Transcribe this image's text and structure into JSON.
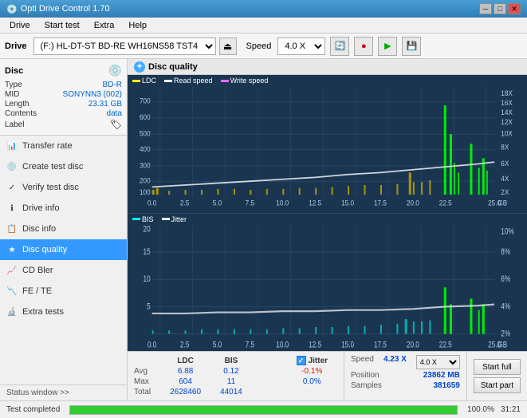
{
  "titlebar": {
    "title": "Opti Drive Control 1.70",
    "icon": "💿",
    "btn_min": "─",
    "btn_max": "□",
    "btn_close": "✕"
  },
  "menubar": {
    "items": [
      "Drive",
      "Start test",
      "Extra",
      "Help"
    ]
  },
  "toolbar": {
    "drive_label": "Drive",
    "drive_value": "(F:)  HL-DT-ST BD-RE  WH16NS58 TST4",
    "eject_icon": "⏏",
    "speed_label": "Speed",
    "speed_value": "4.0 X",
    "icon1": "🔄",
    "icon2": "🔴",
    "icon3": "🟢",
    "icon4": "💾"
  },
  "sidebar": {
    "disc_title": "Disc",
    "disc_icon": "💿",
    "disc_rows": [
      {
        "key": "Type",
        "value": "BD-R"
      },
      {
        "key": "MID",
        "value": "SONYNN3 (002)"
      },
      {
        "key": "Length",
        "value": "23.31 GB"
      },
      {
        "key": "Contents",
        "value": "data"
      },
      {
        "key": "Label",
        "value": ""
      }
    ],
    "nav_items": [
      {
        "id": "transfer-rate",
        "label": "Transfer rate",
        "icon": "📊",
        "active": false
      },
      {
        "id": "create-test-disc",
        "label": "Create test disc",
        "icon": "💿",
        "active": false
      },
      {
        "id": "verify-test-disc",
        "label": "Verify test disc",
        "icon": "✓",
        "active": false
      },
      {
        "id": "drive-info",
        "label": "Drive info",
        "icon": "ℹ",
        "active": false
      },
      {
        "id": "disc-info",
        "label": "Disc info",
        "icon": "📋",
        "active": false
      },
      {
        "id": "disc-quality",
        "label": "Disc quality",
        "icon": "★",
        "active": true
      },
      {
        "id": "cd-bler",
        "label": "CD Bler",
        "icon": "📈",
        "active": false
      },
      {
        "id": "fe-te",
        "label": "FE / TE",
        "icon": "📉",
        "active": false
      },
      {
        "id": "extra-tests",
        "label": "Extra tests",
        "icon": "🔬",
        "active": false
      }
    ],
    "status_window": "Status window >>"
  },
  "panel": {
    "header": "Disc quality",
    "chart1": {
      "legend": [
        {
          "label": "LDC",
          "color": "#ffff00"
        },
        {
          "label": "Read speed",
          "color": "#ffffff"
        },
        {
          "label": "Write speed",
          "color": "#ff66ff"
        }
      ],
      "y_max": 700,
      "y_labels": [
        "700",
        "600",
        "500",
        "400",
        "300",
        "200",
        "100"
      ],
      "y_right": [
        "18X",
        "16X",
        "14X",
        "12X",
        "10X",
        "8X",
        "6X",
        "4X",
        "2X"
      ],
      "x_labels": [
        "0.0",
        "2.5",
        "5.0",
        "7.5",
        "10.0",
        "12.5",
        "15.0",
        "17.5",
        "20.0",
        "22.5",
        "25.0"
      ],
      "x_unit": "GB"
    },
    "chart2": {
      "legend": [
        {
          "label": "BIS",
          "color": "#00ffff"
        },
        {
          "label": "Jitter",
          "color": "#ffffff"
        }
      ],
      "y_max": 20,
      "y_labels": [
        "20",
        "15",
        "10",
        "5"
      ],
      "y_right": [
        "10%",
        "8%",
        "6%",
        "4%",
        "2%"
      ],
      "x_labels": [
        "0.0",
        "2.5",
        "5.0",
        "7.5",
        "10.0",
        "12.5",
        "15.0",
        "17.5",
        "20.0",
        "22.5",
        "25.0"
      ],
      "x_unit": "GB"
    }
  },
  "stats": {
    "col_headers": [
      "LDC",
      "BIS",
      "",
      "Jitter"
    ],
    "rows": [
      {
        "label": "Avg",
        "ldc": "6.88",
        "bis": "0.12",
        "jitter": "-0.1%"
      },
      {
        "label": "Max",
        "ldc": "604",
        "bis": "11",
        "jitter": "0.0%"
      },
      {
        "label": "Total",
        "ldc": "2628460",
        "bis": "44014",
        "jitter": ""
      }
    ],
    "jitter_label": "Jitter",
    "speed_label": "Speed",
    "speed_value": "4.23 X",
    "speed_select": "4.0 X",
    "position_label": "Position",
    "position_value": "23862 MB",
    "samples_label": "Samples",
    "samples_value": "381659",
    "btn_start_full": "Start full",
    "btn_start_part": "Start part"
  },
  "statusbar": {
    "status_text": "Test completed",
    "progress": 100,
    "progress_text": "100.0%",
    "time": "31:21"
  }
}
